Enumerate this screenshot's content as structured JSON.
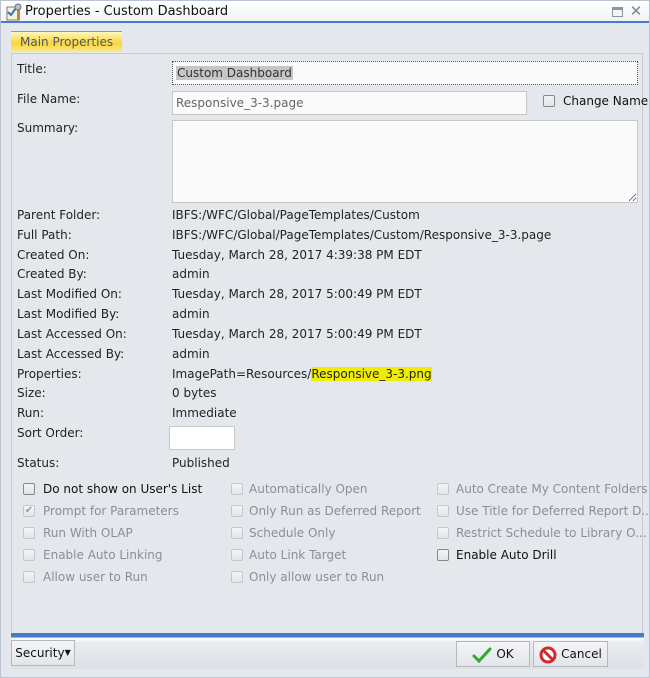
{
  "window": {
    "title": "Properties - Custom Dashboard",
    "icon": "properties-icon",
    "controls": {
      "maximize": "maximize-icon",
      "close": "✕"
    }
  },
  "tabs": [
    {
      "label": "Main Properties",
      "active": true
    }
  ],
  "form": {
    "title_label": "Title:",
    "title_value": "Custom Dashboard",
    "file_name_label": "File Name:",
    "file_name_value": "Responsive_3-3.page",
    "change_name_label": "Change Name",
    "change_name_checked": false,
    "summary_label": "Summary:",
    "summary_value": ""
  },
  "details": {
    "parent_folder_label": "Parent Folder:",
    "parent_folder": "IBFS:/WFC/Global/PageTemplates/Custom",
    "full_path_label": "Full Path:",
    "full_path": "IBFS:/WFC/Global/PageTemplates/Custom/Responsive_3-3.page",
    "created_on_label": "Created On:",
    "created_on": "Tuesday, March 28, 2017 4:39:38 PM EDT",
    "created_by_label": "Created By:",
    "created_by": "admin",
    "last_modified_on_label": "Last Modified On:",
    "last_modified_on": "Tuesday, March 28, 2017 5:00:49 PM EDT",
    "last_modified_by_label": "Last Modified By:",
    "last_modified_by": "admin",
    "last_accessed_on_label": "Last Accessed On:",
    "last_accessed_on": "Tuesday, March 28, 2017 5:00:49 PM EDT",
    "last_accessed_by_label": "Last Accessed By:",
    "last_accessed_by": "admin",
    "properties_label": "Properties:",
    "properties_prefix": "ImagePath=Resources/",
    "properties_highlight": "Responsive_3-3.png",
    "size_label": "Size:",
    "size": "0 bytes",
    "run_label": "Run:",
    "run": "Immediate",
    "sort_order_label": "Sort Order:",
    "sort_order": "",
    "status_label": "Status:",
    "status": "Published"
  },
  "options": {
    "col1": [
      {
        "label": "Do not show on User's List",
        "checked": false,
        "enabled": true
      },
      {
        "label": "Prompt for Parameters",
        "checked": true,
        "enabled": false
      },
      {
        "label": "Run With OLAP",
        "checked": false,
        "enabled": false
      },
      {
        "label": "Enable Auto Linking",
        "checked": false,
        "enabled": false
      },
      {
        "label": "Allow user to Run",
        "checked": false,
        "enabled": false
      }
    ],
    "col2": [
      {
        "label": "Automatically Open",
        "checked": false,
        "enabled": false
      },
      {
        "label": "Only Run as Deferred Report",
        "checked": false,
        "enabled": false
      },
      {
        "label": "Schedule Only",
        "checked": false,
        "enabled": false
      },
      {
        "label": "Auto Link Target",
        "checked": false,
        "enabled": false
      },
      {
        "label": "Only allow user to Run",
        "checked": false,
        "enabled": false
      }
    ],
    "col3": [
      {
        "label": "Auto Create My Content Folders",
        "checked": false,
        "enabled": false
      },
      {
        "label": "Use Title for Deferred Report D...",
        "checked": false,
        "enabled": false
      },
      {
        "label": "Restrict Schedule to Library O...",
        "checked": false,
        "enabled": false
      },
      {
        "label": "Enable Auto Drill",
        "checked": false,
        "enabled": true
      }
    ]
  },
  "footer": {
    "security_label": "Security",
    "ok_label": "OK",
    "cancel_label": "Cancel"
  },
  "colors": {
    "accent": "#4a7acc",
    "tab_highlight": "#f9d63a",
    "text_highlight": "#f0ee00",
    "ok_check": "#2eaa2e",
    "cancel_red": "#d42a2a"
  }
}
